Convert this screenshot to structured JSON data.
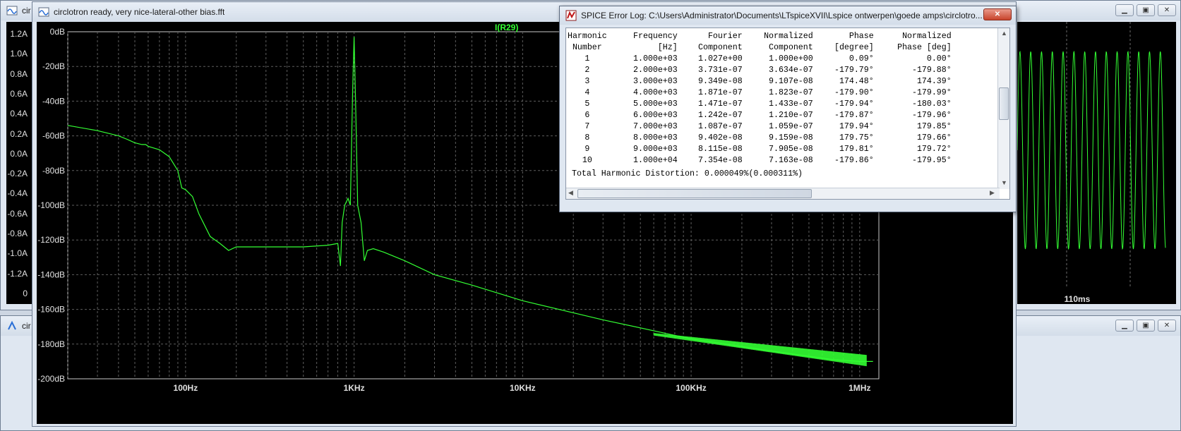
{
  "windows": {
    "top_title": "cir",
    "bottom_title": "cir",
    "right_time_label": "110ms"
  },
  "left_axis": [
    "1.2A",
    "1.0A",
    "0.8A",
    "0.6A",
    "0.4A",
    "0.2A",
    "0.0A",
    "-0.2A",
    "-0.4A",
    "-0.6A",
    "-0.8A",
    "-1.0A",
    "-1.2A",
    "0"
  ],
  "fft_window": {
    "title": "circlotron ready, very nice-lateral-other bias.fft",
    "trace_label": "I(R29)"
  },
  "dialog": {
    "title": "SPICE Error Log: C:\\Users\\Administrator\\Documents\\LTspiceXVII\\Lspice ontwerpen\\goede amps\\circlotro...",
    "header1": [
      "Harmonic",
      "Frequency",
      "Fourier",
      "Normalized",
      "Phase",
      "Normalized"
    ],
    "header2": [
      "Number",
      "[Hz]",
      "Component",
      "Component",
      "[degree]",
      "Phase [deg]"
    ],
    "rows": [
      [
        "1",
        "1.000e+03",
        "1.027e+00",
        "1.000e+00",
        "0.09°",
        "0.00°"
      ],
      [
        "2",
        "2.000e+03",
        "3.731e-07",
        "3.634e-07",
        "-179.79°",
        "-179.88°"
      ],
      [
        "3",
        "3.000e+03",
        "9.349e-08",
        "9.107e-08",
        "174.48°",
        "174.39°"
      ],
      [
        "4",
        "4.000e+03",
        "1.871e-07",
        "1.823e-07",
        "-179.90°",
        "-179.99°"
      ],
      [
        "5",
        "5.000e+03",
        "1.471e-07",
        "1.433e-07",
        "-179.94°",
        "-180.03°"
      ],
      [
        "6",
        "6.000e+03",
        "1.242e-07",
        "1.210e-07",
        "-179.87°",
        "-179.96°"
      ],
      [
        "7",
        "7.000e+03",
        "1.087e-07",
        "1.059e-07",
        "179.94°",
        "179.85°"
      ],
      [
        "8",
        "8.000e+03",
        "9.402e-08",
        "9.159e-08",
        "179.75°",
        "179.66°"
      ],
      [
        "9",
        "9.000e+03",
        "8.115e-08",
        "7.905e-08",
        "179.81°",
        "179.72°"
      ],
      [
        "10",
        "1.000e+04",
        "7.354e-08",
        "7.163e-08",
        "-179.86°",
        "-179.95°"
      ]
    ],
    "thd": "Total Harmonic Distortion: 0.000049%(0.000311%)"
  },
  "chart_data": {
    "type": "line",
    "title": "I(R29)",
    "xscale": "log",
    "xlim": [
      20,
      1300000
    ],
    "ylim": [
      -200,
      0
    ],
    "grid": true,
    "y_ticks": [
      "0dB",
      "-20dB",
      "-40dB",
      "-60dB",
      "-80dB",
      "-100dB",
      "-120dB",
      "-140dB",
      "-160dB",
      "-180dB",
      "-200dB"
    ],
    "x_ticks": [
      "100Hz",
      "1KHz",
      "10KHz",
      "100KHz",
      "1MHz"
    ],
    "series": [
      {
        "name": "I(R29)",
        "color": "#33ff33",
        "x": [
          20,
          30,
          40,
          45,
          50,
          55,
          58,
          60,
          70,
          80,
          90,
          95,
          100,
          110,
          120,
          140,
          160,
          180,
          200,
          300,
          500,
          700,
          800,
          830,
          850,
          880,
          920,
          950,
          980,
          1000,
          1020,
          1050,
          1100,
          1150,
          1200,
          1300,
          1500,
          2000,
          3000,
          5000,
          10000,
          30000,
          100000,
          300000,
          700000,
          1000000,
          1200000
        ],
        "y": [
          -54,
          -57,
          -60,
          -62,
          -64,
          -65,
          -65,
          -66,
          -68,
          -72,
          -80,
          -90,
          -91,
          -95,
          -105,
          -118,
          -122,
          -126,
          -124,
          -124,
          -124,
          -123,
          -122,
          -135,
          -110,
          -100,
          -96,
          -100,
          -35,
          -3,
          -40,
          -100,
          -110,
          -132,
          -126,
          -125,
          -127,
          -132,
          -140,
          -146,
          -155,
          -166,
          -177,
          -184,
          -189,
          -190,
          -190
        ]
      }
    ]
  }
}
